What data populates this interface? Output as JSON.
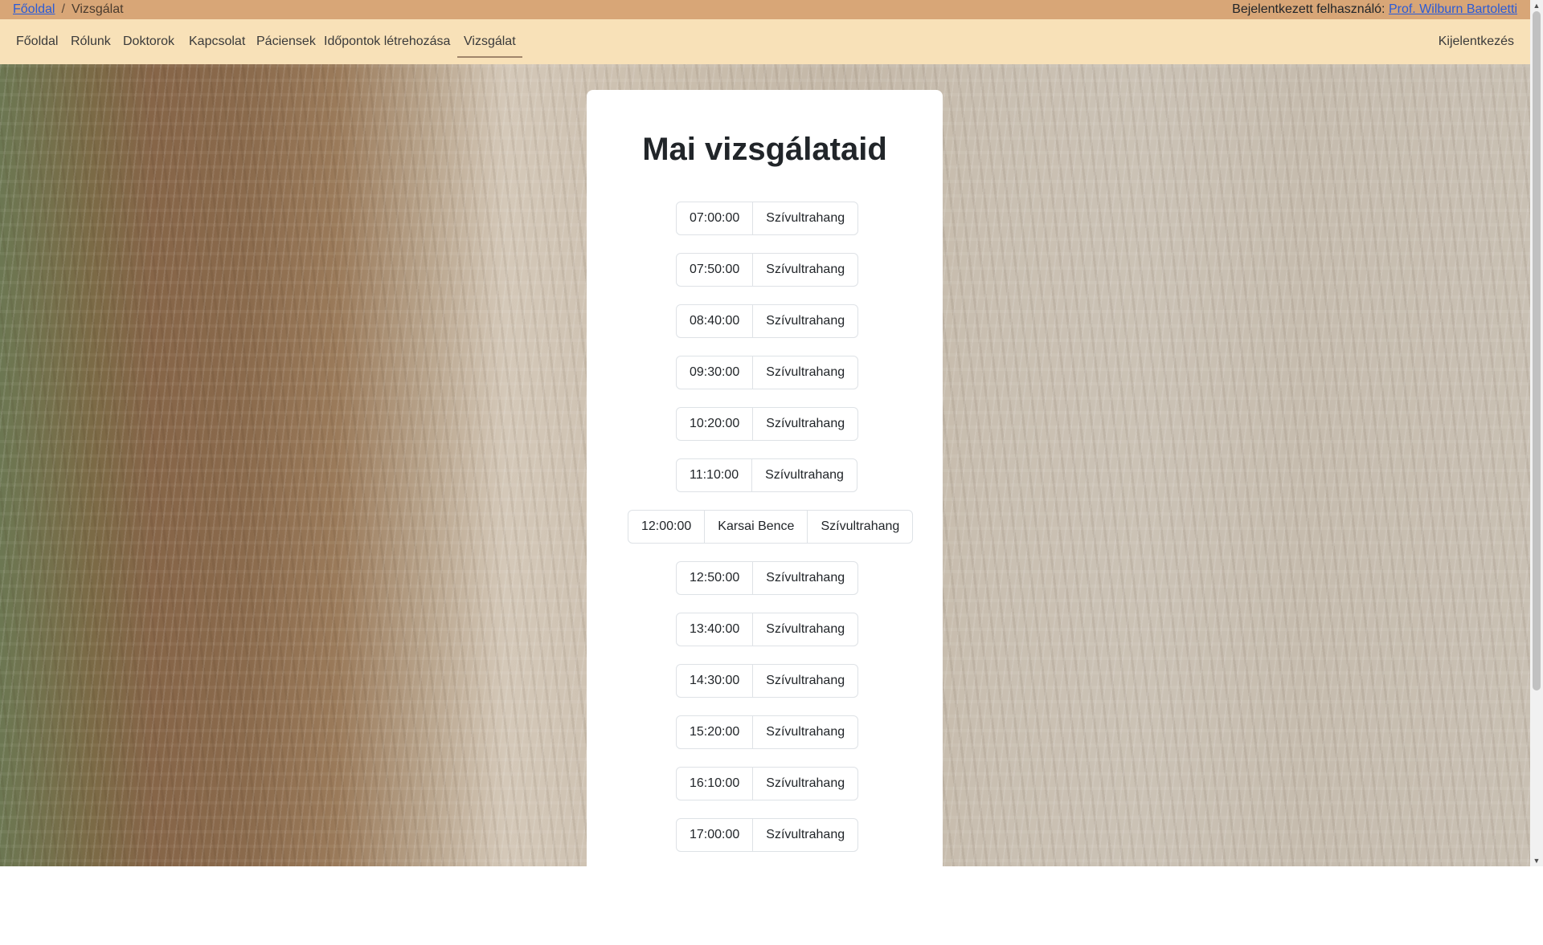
{
  "breadcrumb": {
    "home_label": "Főoldal",
    "separator": "/",
    "current_label": "Vizsgálat"
  },
  "user": {
    "prefix": "Bejelentkezett felhasználó:",
    "name": "Prof. Wilburn Bartoletti"
  },
  "nav": {
    "items": [
      "Főoldal",
      "Rólunk",
      "Doktorok",
      "Kapcsolat",
      "Páciensek",
      "Időpontok létrehozása",
      "Vizsgálat"
    ],
    "active_index": 6,
    "logout_label": "Kijelentkezés"
  },
  "main": {
    "title": "Mai vizsgálataid",
    "appointments": [
      {
        "time": "07:00:00",
        "patient": "",
        "type": "Szívultrahang"
      },
      {
        "time": "07:50:00",
        "patient": "",
        "type": "Szívultrahang"
      },
      {
        "time": "08:40:00",
        "patient": "",
        "type": "Szívultrahang"
      },
      {
        "time": "09:30:00",
        "patient": "",
        "type": "Szívultrahang"
      },
      {
        "time": "10:20:00",
        "patient": "",
        "type": "Szívultrahang"
      },
      {
        "time": "11:10:00",
        "patient": "",
        "type": "Szívultrahang"
      },
      {
        "time": "12:00:00",
        "patient": "Karsai Bence",
        "type": "Szívultrahang"
      },
      {
        "time": "12:50:00",
        "patient": "",
        "type": "Szívultrahang"
      },
      {
        "time": "13:40:00",
        "patient": "",
        "type": "Szívultrahang"
      },
      {
        "time": "14:30:00",
        "patient": "",
        "type": "Szívultrahang"
      },
      {
        "time": "15:20:00",
        "patient": "",
        "type": "Szívultrahang"
      },
      {
        "time": "16:10:00",
        "patient": "",
        "type": "Szívultrahang"
      },
      {
        "time": "17:00:00",
        "patient": "",
        "type": "Szívultrahang"
      }
    ]
  },
  "colors": {
    "topbar": "#d8a677",
    "navbar": "#f8e1b8",
    "link": "#2a5bd7"
  }
}
